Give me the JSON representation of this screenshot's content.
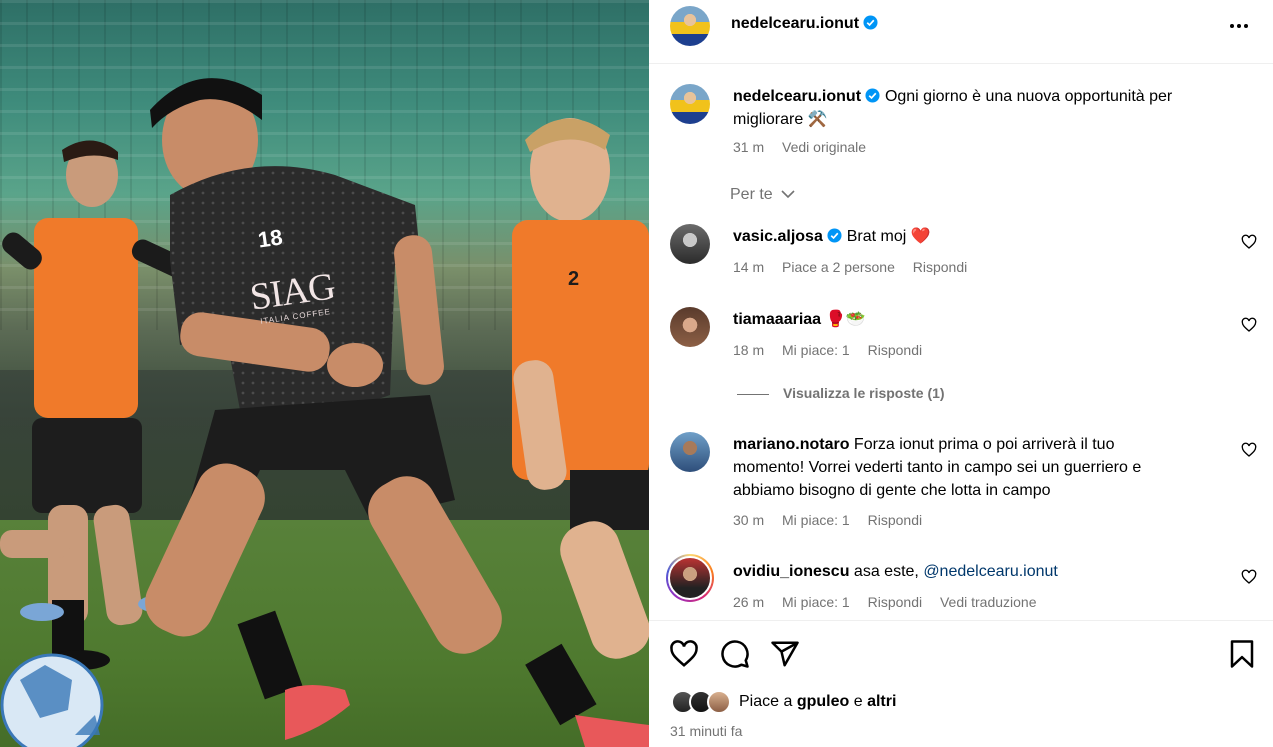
{
  "post": {
    "author": "nedelcearu.ionut",
    "caption": "Ogni giorno è una nuova opportunità per",
    "caption_line2": "migliorare",
    "caption_emoji": "⚒️",
    "caption_time": "31 m",
    "see_original": "Vedi originale"
  },
  "sort": {
    "label": "Per te"
  },
  "comments": [
    {
      "user": "vasic.aljosa",
      "verified": true,
      "text": "Brat moj",
      "emoji": "❤️",
      "time": "14 m",
      "likes": "Piace a 2 persone",
      "reply": "Rispondi"
    },
    {
      "user": "tiamaaariaa",
      "verified": false,
      "text": "",
      "emoji": "🥊🥗",
      "time": "18 m",
      "likes": "Mi piace: 1",
      "reply": "Rispondi",
      "view_replies": "Visualizza le risposte (1)"
    },
    {
      "user": "mariano.notaro",
      "verified": false,
      "text_line1": "Forza ionut prima o poi arriverà il tuo",
      "text_line2": "momento! Vorrei vederti tanto in campo sei un guerriero e",
      "text_line3": "abbiamo bisogno di gente che lotta in campo",
      "time": "30 m",
      "likes": "Mi piace: 1",
      "reply": "Rispondi"
    },
    {
      "user": "ovidiu_ionescu",
      "verified": false,
      "text": "asa este,",
      "mention": "@nedelcearu.ionut",
      "time": "26 m",
      "likes": "Mi piace: 1",
      "reply": "Rispondi",
      "translate": "Vedi traduzione"
    }
  ],
  "footer": {
    "liked_prefix": "Piace a",
    "liked_user": "gpuleo",
    "liked_and": "e",
    "liked_others": "altri",
    "timestamp": "31 minuti fa"
  },
  "photo": {
    "jersey_number": "18",
    "sponsor": "SIAG",
    "sponsor_sub": "ITALIA COFFEE",
    "bib_number": "2"
  },
  "colors": {
    "verified": "#0095f6",
    "link": "#00376b",
    "meta": "#737373"
  },
  "icons": [
    "more-options-icon",
    "verified-icon",
    "chevron-down-icon",
    "like-icon",
    "comment-icon",
    "share-icon",
    "save-icon"
  ]
}
